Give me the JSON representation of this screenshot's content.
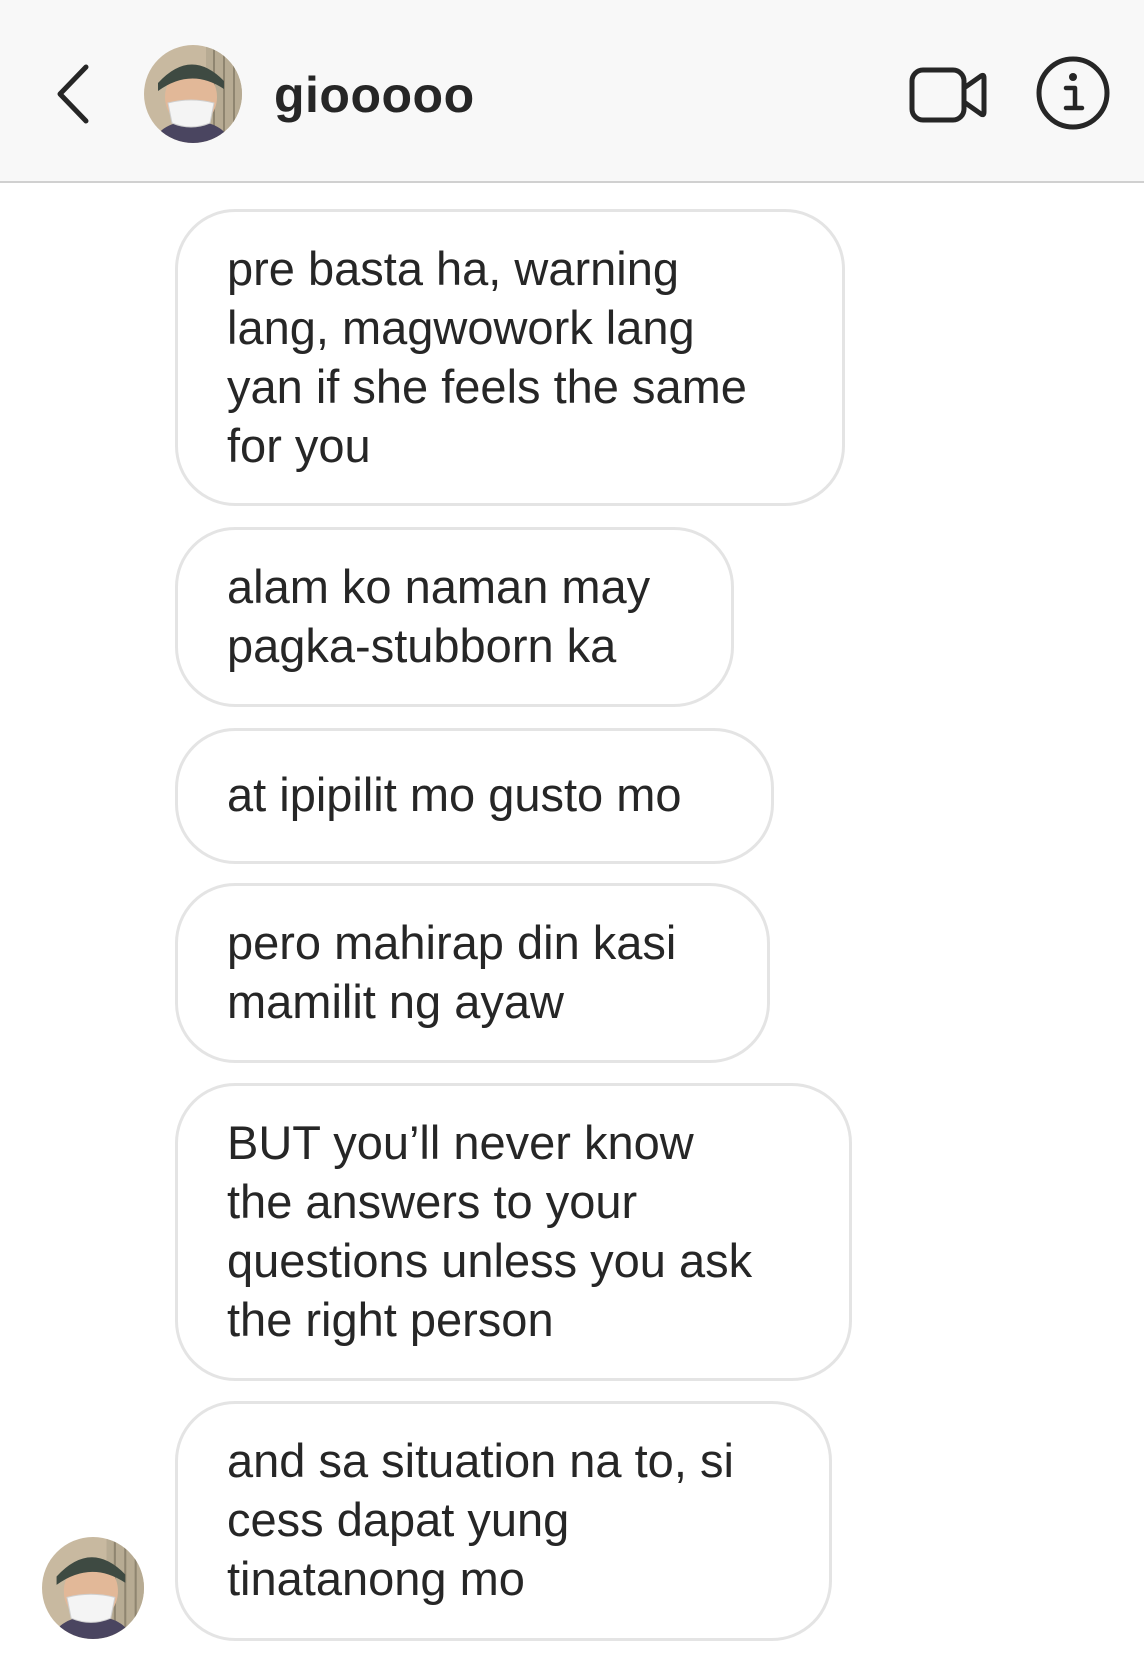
{
  "header": {
    "username": "giooooo",
    "back_icon": "chevron-left-icon",
    "video_icon": "video-camera-icon",
    "info_icon": "info-icon"
  },
  "messages": [
    {
      "text": "pre basta ha, warning\nlang, magwowork lang\nyan if she feels the same\nfor you"
    },
    {
      "text": "alam ko naman may\npagka-stubborn ka"
    },
    {
      "text": "at ipipilit mo gusto mo"
    },
    {
      "text": "pero mahirap din kasi\nmamilit ng ayaw"
    },
    {
      "text": "BUT you’ll never know\nthe answers to your\nquestions unless you ask\nthe right person"
    },
    {
      "text": "and sa situation na to, si\ncess dapat yung\ntinatanong mo"
    }
  ],
  "colors": {
    "header_bg": "#f8f8f8",
    "bubble_border": "#e4e4e4",
    "text": "#262626"
  }
}
